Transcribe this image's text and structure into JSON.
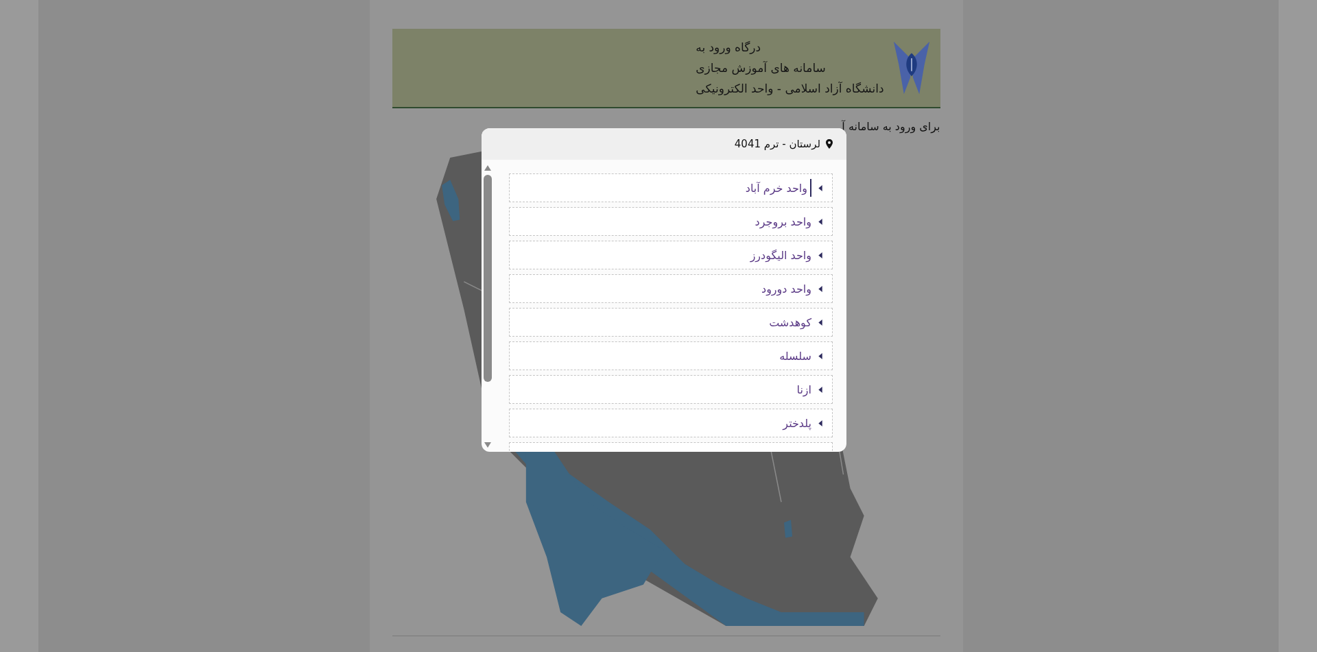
{
  "header": {
    "lines": [
      "درگاه ورود به",
      "سامانه های آموزش مجازی",
      "دانشگاه آزاد اسلامی - واحد الکترونیکی"
    ]
  },
  "intro": "برای ورود به سامانه آ",
  "dialog": {
    "title": "لرستان - ترم 4041",
    "items": [
      {
        "label": "واحد خرم آباد",
        "focused": true
      },
      {
        "label": "واحد بروجرد",
        "focused": false
      },
      {
        "label": "واحد الیگودرز",
        "focused": false
      },
      {
        "label": "واحد دورود",
        "focused": false
      },
      {
        "label": "کوهدشت",
        "focused": false
      },
      {
        "label": "سلسله",
        "focused": false
      },
      {
        "label": "ازنا",
        "focused": false
      },
      {
        "label": "پلدختر",
        "focused": false
      }
    ]
  }
}
